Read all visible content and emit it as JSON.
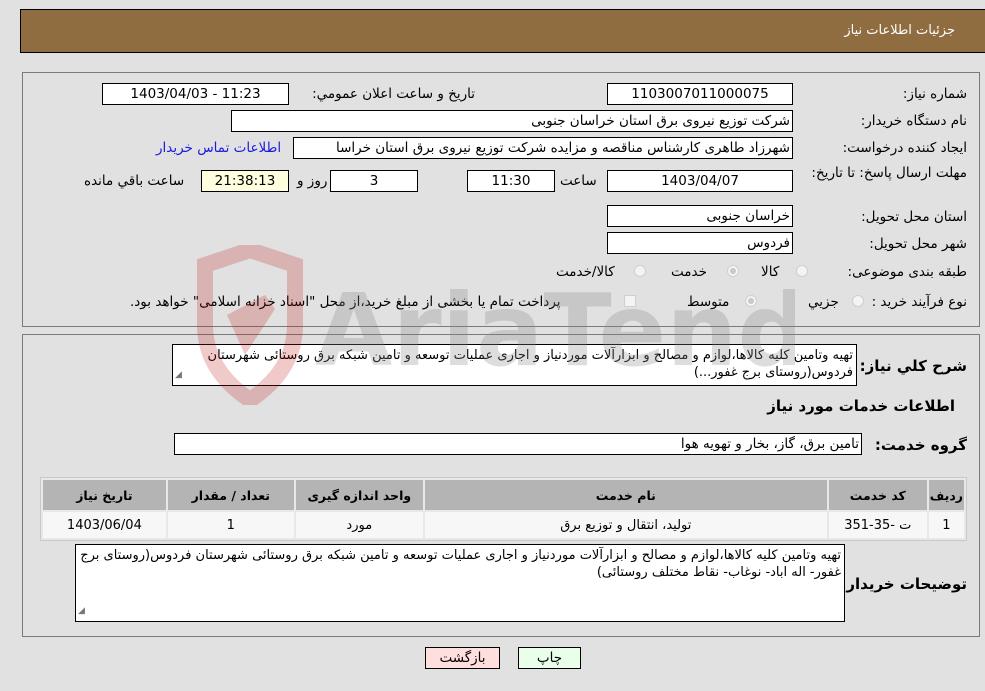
{
  "header": {
    "title": "جزئیات اطلاعات نیاز"
  },
  "details": {
    "need_number": {
      "label": "شماره نیاز:",
      "value": "1103007011000075"
    },
    "announce_datetime": {
      "label": "تاريخ و ساعت اعلان عمومي:",
      "value": "1403/04/03 - 11:23"
    },
    "buyer_org": {
      "label": "نام دستگاه خريدار:",
      "value": "شرکت توزیع نیروی برق استان خراسان جنوبی"
    },
    "requester": {
      "label": "ايجاد کننده درخواست:",
      "value": "شهرزاد طاهری کارشناس مناقصه و مزایده شرکت توزیع نیروی برق استان خراسا"
    },
    "buyer_contact_link": "اطلاعات تماس خريدار",
    "deadline": {
      "label": "مهلت ارسال پاسخ: تا تاریخ:",
      "date": "1403/04/07",
      "time_label": "ساعت",
      "time": "11:30",
      "days": "3",
      "days_label": "روز و",
      "remaining": "21:38:13",
      "remaining_label": "ساعت باقي مانده"
    },
    "delivery_province": {
      "label": "استان محل تحويل:",
      "value": "خراسان جنوبی"
    },
    "delivery_city": {
      "label": "شهر محل تحويل:",
      "value": "فردوس"
    },
    "category": {
      "label": "طبقه بندی موضوعی:",
      "options": [
        {
          "label": "کالا",
          "selected": false
        },
        {
          "label": "خدمت",
          "selected": true
        },
        {
          "label": "کالا/خدمت",
          "selected": false
        }
      ]
    },
    "purchase_type": {
      "label": "نوع فرآيند خريد :",
      "options": [
        {
          "label": "جزيي",
          "selected": false
        },
        {
          "label": "متوسط",
          "selected": true
        }
      ],
      "treasury_checkbox_label": "پرداخت تمام يا بخشی از مبلغ خريد،از محل \"اسناد خزانه اسلامی\" خواهد بود.",
      "treasury_checked": false
    }
  },
  "description": {
    "label": "شرح کلي نياز:",
    "value": "تهیه وتامین کلیه کالاها،لوازم و مصالح و ابزارآلات موردنیاز و اجاری عملیات توسعه و تامین شبکه برق روستائی شهرستان فردوس(روستای برج غفور...)"
  },
  "services": {
    "section_title": "اطلاعات خدمات مورد نیاز",
    "group_label": "گروه خدمت:",
    "group_value": "تامین برق، گاز، بخار و تهویه هوا",
    "columns": [
      "رديف",
      "کد خدمت",
      "نام خدمت",
      "واحد اندازه گيری",
      "تعداد / مقدار",
      "تاريخ نياز"
    ],
    "rows": [
      [
        "1",
        "ت -35-351",
        "تولید، انتقال و توزیع برق",
        "مورد",
        "1",
        "1403/06/04"
      ]
    ]
  },
  "buyer_notes": {
    "label": "توضيحات خريدار:",
    "value": "تهیه وتامین کلیه کالاها،لوازم و مصالح و ابزارآلات موردنیاز و اجاری عملیات توسعه و تامین شبکه برق روستائی شهرستان فردوس(روستای برج غفور- اله اباد- نوغاب- نقاط مختلف روستائی)"
  },
  "buttons": {
    "print": "چاپ",
    "back": "بازگشت"
  },
  "watermark": {
    "text": "AriaTender.neT"
  },
  "colors": {
    "header": "#8f6d40",
    "print_bg": "#eaffea",
    "back_bg": "#ffdede",
    "link": "#1a1ae0"
  }
}
